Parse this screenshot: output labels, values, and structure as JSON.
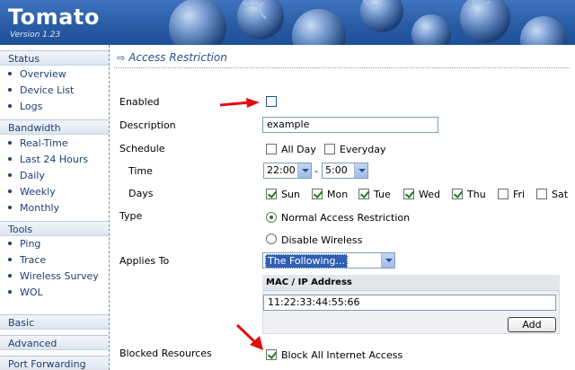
{
  "header": {
    "brand": "Tomato",
    "version": "Version 1.23"
  },
  "colors": {
    "accent": "#2a4e8a",
    "header_bg": "#2d5fa8",
    "check": "#1c7a1c",
    "arrow": "#e01010"
  },
  "sidebar": {
    "sections": [
      {
        "label": "Status",
        "items": [
          "Overview",
          "Device List",
          "Logs"
        ]
      },
      {
        "label": "Bandwidth",
        "items": [
          "Real-Time",
          "Last 24 Hours",
          "Daily",
          "Weekly",
          "Monthly"
        ]
      },
      {
        "label": "Tools",
        "items": [
          "Ping",
          "Trace",
          "Wireless Survey",
          "WOL"
        ]
      },
      {
        "label": "Basic",
        "items": []
      },
      {
        "label": "Advanced",
        "items": []
      },
      {
        "label": "Port Forwarding",
        "items": []
      }
    ]
  },
  "page": {
    "title": "Access Restriction",
    "title_icon": "double-arrow-icon"
  },
  "form": {
    "enabled": {
      "label": "Enabled",
      "checked": false
    },
    "description": {
      "label": "Description",
      "value": "example"
    },
    "schedule": {
      "label": "Schedule",
      "all_day": {
        "label": "All Day",
        "checked": false
      },
      "everyday": {
        "label": "Everyday",
        "checked": false
      }
    },
    "time": {
      "label": "Time",
      "start": "22:00",
      "separator": "-",
      "end": "5:00"
    },
    "days": {
      "label": "Days",
      "items": [
        {
          "label": "Sun",
          "checked": true
        },
        {
          "label": "Mon",
          "checked": true
        },
        {
          "label": "Tue",
          "checked": true
        },
        {
          "label": "Wed",
          "checked": true
        },
        {
          "label": "Thu",
          "checked": true
        },
        {
          "label": "Fri",
          "checked": false
        },
        {
          "label": "Sat",
          "checked": false
        }
      ]
    },
    "type": {
      "label": "Type",
      "options": [
        {
          "label": "Normal Access Restriction",
          "selected": true
        },
        {
          "label": "Disable Wireless",
          "selected": false
        }
      ]
    },
    "applies_to": {
      "label": "Applies To",
      "value": "The Following...",
      "table_header": "MAC / IP Address",
      "entry_value": "11:22:33:44:55:66",
      "add_label": "Add"
    },
    "blocked": {
      "label": "Blocked Resources",
      "block_all": {
        "label": "Block All Internet Access",
        "checked": true
      }
    }
  }
}
